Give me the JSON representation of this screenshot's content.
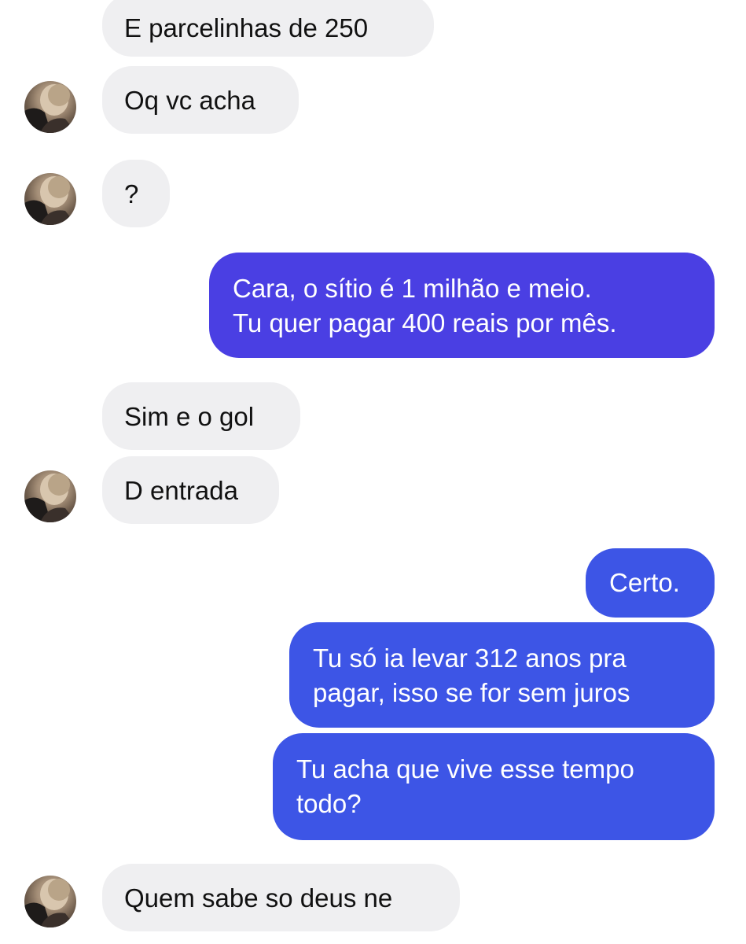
{
  "conversation": {
    "messages": [
      {
        "from": "them",
        "lines": [
          "E parcelinhas de 250"
        ]
      },
      {
        "from": "them",
        "lines": [
          "Oq vc acha"
        ]
      },
      {
        "from": "them",
        "lines": [
          "?"
        ]
      },
      {
        "from": "me",
        "lines": [
          "Cara, o sítio  é 1 milhão e meio.",
          "Tu quer pagar 400 reais por mês."
        ]
      },
      {
        "from": "them",
        "lines": [
          "Sim e o gol"
        ]
      },
      {
        "from": "them",
        "lines": [
          "D entrada"
        ]
      },
      {
        "from": "me",
        "lines": [
          "Certo."
        ]
      },
      {
        "from": "me",
        "lines": [
          "Tu só ia levar 312 anos pra",
          "pagar, isso se for sem juros"
        ]
      },
      {
        "from": "me",
        "lines": [
          "Tu acha que vive esse tempo",
          "todo?"
        ]
      },
      {
        "from": "them",
        "lines": [
          "Quem sabe so deus ne"
        ]
      }
    ]
  },
  "colors": {
    "incoming_bubble": "#efeff1",
    "outgoing_bubble_purple": "#4a3fe3",
    "outgoing_bubble_blue": "#3d55e6",
    "incoming_text": "#111111",
    "outgoing_text": "#ffffff"
  },
  "icons": {
    "avatar": "contact-avatar-photo"
  }
}
